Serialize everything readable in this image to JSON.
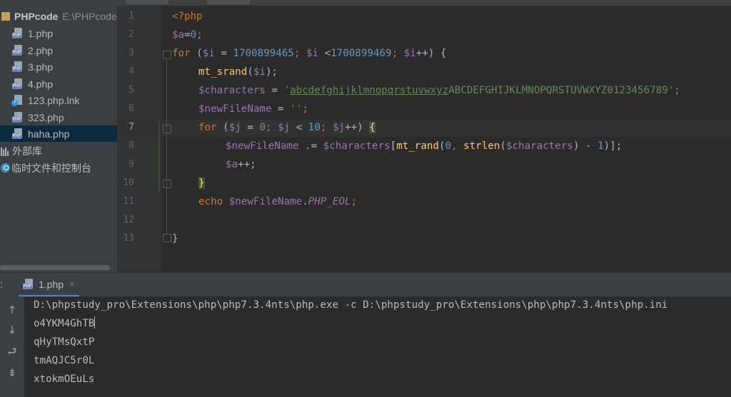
{
  "project": {
    "root_name": "PHPcode",
    "root_path": "E:\\PHPcode",
    "files": [
      {
        "label": "1.php",
        "icon": "php-file-icon"
      },
      {
        "label": "2.php",
        "icon": "php-file-icon"
      },
      {
        "label": "3.php",
        "icon": "php-file-icon"
      },
      {
        "label": "4.php",
        "icon": "php-file-icon"
      },
      {
        "label": "123.php.lnk",
        "icon": "link-file-icon"
      },
      {
        "label": "323.php",
        "icon": "php-file-icon"
      },
      {
        "label": "haha.php",
        "icon": "php-file-icon",
        "selected": true
      }
    ],
    "external_libraries": "外部库",
    "scratches": "临时文件和控制台"
  },
  "editor": {
    "line_numbers": [
      "1",
      "2",
      "3",
      "4",
      "5",
      "6",
      "7",
      "8",
      "9",
      "10",
      "11",
      "12",
      "13"
    ],
    "active_line": 7,
    "code": {
      "l1_open": "<?php",
      "l2_var": "$a",
      "l2_eq": "=",
      "l2_num": "0",
      "l2_semi": ";",
      "l3_for": "for",
      "l3_paren": " (",
      "l3_var_i": "$i",
      "l3_assign": " = ",
      "l3_start": "1700899465",
      "l3_semi1": "; ",
      "l3_var_i2": "$i",
      "l3_lt": " <",
      "l3_end": "1700899469",
      "l3_semi2": "; ",
      "l3_var_i3": "$i",
      "l3_inc": "++) {",
      "l4_fn": "mt_srand",
      "l4_open": "(",
      "l4_var": "$i",
      "l4_close": ");",
      "l5_var": "$characters",
      "l5_eq": " = ",
      "l5_q1": "'",
      "l5_str_lower": "abcdefghijklmnopqrstuvwxyz",
      "l5_str_rest": "ABCDEFGHIJKLMNOPQRSTUVWXYZ0123456789",
      "l5_q2": "'",
      "l5_semi": ";",
      "l6_var": "$newFileName",
      "l6_eq": " = ",
      "l6_str": "''",
      "l6_semi": ";",
      "l7_for": "for",
      "l7_paren": " (",
      "l7_var_j": "$j",
      "l7_assign": " = ",
      "l7_zero": "0",
      "l7_semi1": "; ",
      "l7_var_j2": "$j",
      "l7_lt": " < ",
      "l7_ten": "10",
      "l7_semi2": "; ",
      "l7_var_j3": "$j",
      "l7_inc": "++) ",
      "l7_brace": "{",
      "l8_var": "$newFileName",
      "l8_op": " .= ",
      "l8_var2": "$characters",
      "l8_br": "[",
      "l8_fn": "mt_rand",
      "l8_p1": "(",
      "l8_zero": "0",
      "l8_comma": ", ",
      "l8_fn2": "strlen",
      "l8_p2": "(",
      "l8_var3": "$characters",
      "l8_minus": ") - ",
      "l8_one": "1",
      "l8_end": ")];",
      "l9_var": "$a",
      "l9_inc": "++;",
      "l10_brace": "}",
      "l11_echo": "echo",
      "l11_sp": " ",
      "l11_var": "$newFileName",
      "l11_dot": ".",
      "l11_const": "PHP_EOL",
      "l11_semi": ";",
      "l13_brace": "}"
    }
  },
  "run": {
    "prefix": ":",
    "tab_label": "1.php",
    "close_glyph": "×",
    "toolbar": {
      "up": "↑",
      "down": "↓",
      "wrap": "⮐",
      "sort": "⇟"
    },
    "output": [
      "D:\\phpstudy_pro\\Extensions\\php\\php7.3.4nts\\php.exe -c D:\\phpstudy_pro\\Extensions\\php\\php7.3.4nts\\php.ini",
      "o4YKM4GhTB",
      "qHyTMsQxtP",
      "tmAQJC5r0L",
      "xtokmOEuLs"
    ]
  }
}
